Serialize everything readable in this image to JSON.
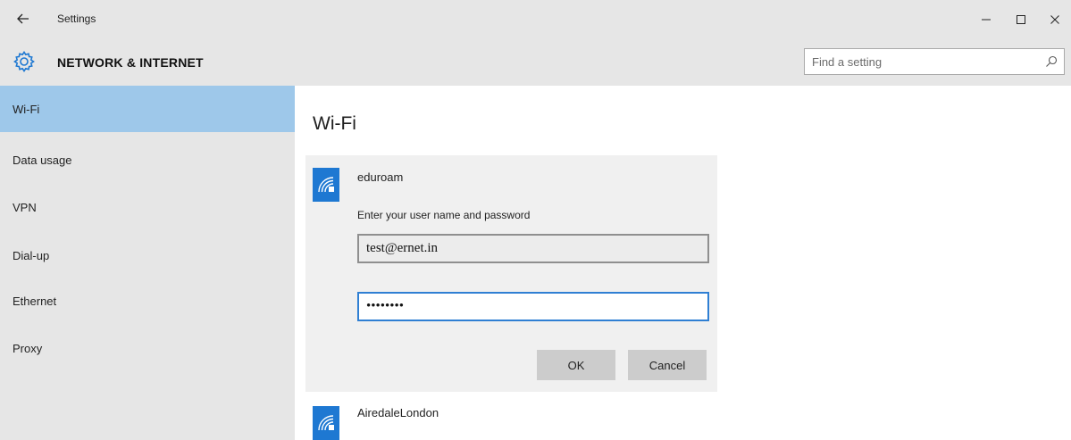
{
  "window": {
    "back_icon": "back-arrow-icon",
    "title": "Settings",
    "controls": {
      "minimize_icon": "minimize-icon",
      "maximize_icon": "maximize-icon",
      "close_icon": "close-icon"
    }
  },
  "header": {
    "icon": "gear-icon",
    "title": "NETWORK & INTERNET",
    "search": {
      "value": "",
      "placeholder": "Find a setting",
      "icon": "search-icon"
    }
  },
  "sidebar": {
    "items": [
      {
        "label": "Wi-Fi",
        "selected": true
      },
      {
        "label": "Data usage",
        "selected": false
      },
      {
        "label": "VPN",
        "selected": false
      },
      {
        "label": "Dial-up",
        "selected": false
      },
      {
        "label": "Ethernet",
        "selected": false
      },
      {
        "label": "Proxy",
        "selected": false
      }
    ]
  },
  "main": {
    "title": "Wi-Fi",
    "networks": [
      {
        "name": "eduroam",
        "icon": "wifi-secure-icon",
        "expanded": true,
        "prompt": "Enter your user name and password",
        "username": "test@ernet.in",
        "password": "••••••••",
        "ok_label": "OK",
        "cancel_label": "Cancel"
      },
      {
        "name": "AiredaleLondon",
        "icon": "wifi-secure-icon",
        "expanded": false
      }
    ]
  },
  "colors": {
    "accent": "#1e78d2",
    "selected_nav": "#9ec8ea",
    "chrome": "#e6e6e6",
    "focus_border": "#2f7fd3"
  }
}
